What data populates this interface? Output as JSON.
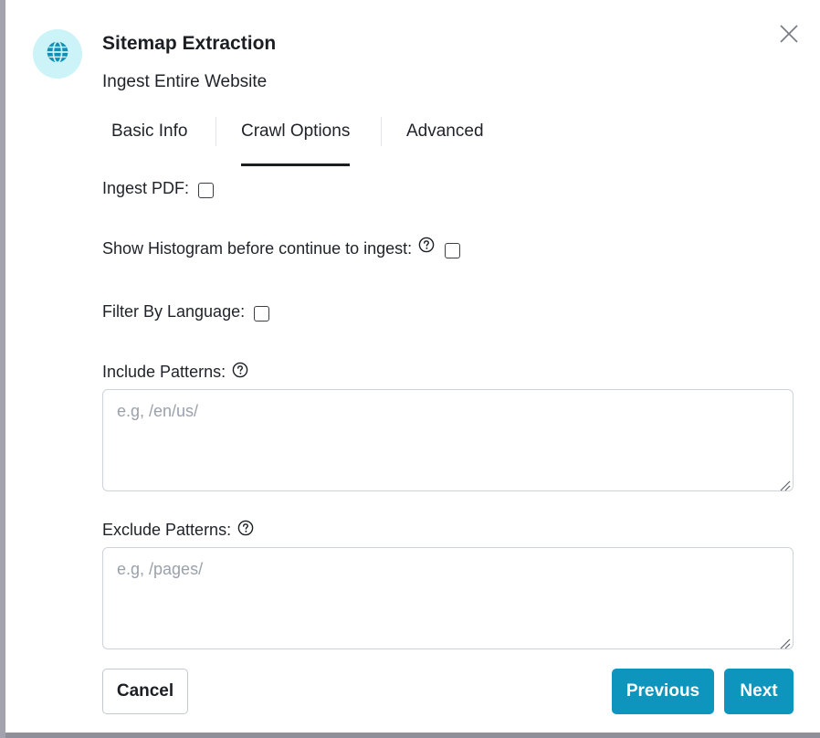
{
  "dialog": {
    "title": "Sitemap Extraction",
    "subtitle": "Ingest Entire Website",
    "logo_icon": "globe-icon",
    "close_icon": "close-icon"
  },
  "tabs": [
    {
      "label": "Basic Info",
      "active": false
    },
    {
      "label": "Crawl Options",
      "active": true
    },
    {
      "label": "Advanced",
      "active": false
    }
  ],
  "fields": {
    "ingest_pdf": {
      "label": "Ingest PDF:",
      "checked": false
    },
    "show_histogram": {
      "label": "Show Histogram before continue to ingest:",
      "checked": false,
      "has_help": true
    },
    "filter_language": {
      "label": "Filter By Language:",
      "checked": false
    },
    "include_patterns": {
      "label": "Include Patterns:",
      "placeholder": "e.g, /en/us/",
      "value": "",
      "has_help": true
    },
    "exclude_patterns": {
      "label": "Exclude Patterns:",
      "placeholder": "e.g, /pages/",
      "value": "",
      "has_help": true
    }
  },
  "buttons": {
    "cancel": "Cancel",
    "previous": "Previous",
    "next": "Next"
  },
  "colors": {
    "accent": "#0e95bd",
    "logo_bg": "#ccf3f8",
    "logo_icon": "#0e8fb5",
    "backdrop": "#8f8f99"
  }
}
